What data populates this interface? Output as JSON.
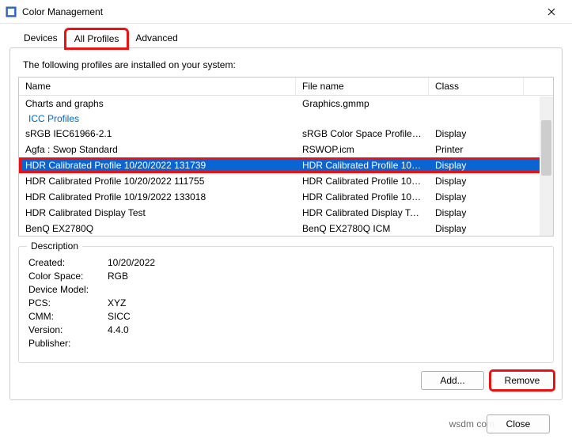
{
  "window": {
    "title": "Color Management"
  },
  "tabs": {
    "devices": "Devices",
    "all_profiles": "All Profiles",
    "advanced": "Advanced"
  },
  "intro": "The following profiles are installed on your system:",
  "columns": {
    "name": "Name",
    "file": "File name",
    "class": "Class"
  },
  "groups": {
    "icc": "ICC Profiles"
  },
  "rows": {
    "r0": {
      "name": "Charts and graphs",
      "file": "Graphics.gmmp",
      "class": ""
    },
    "r1": {
      "name": "sRGB IEC61966-2.1",
      "file": "sRGB Color Space Profile.ic...",
      "class": "Display"
    },
    "r2": {
      "name": "Agfa : Swop Standard",
      "file": "RSWOP.icm",
      "class": "Printer"
    },
    "r3": {
      "name": "HDR Calibrated Profile 10/20/2022 131739",
      "file": "HDR Calibrated Profile 10-...",
      "class": "Display"
    },
    "r4": {
      "name": "HDR Calibrated Profile 10/20/2022 111755",
      "file": "HDR Calibrated Profile 10-...",
      "class": "Display"
    },
    "r5": {
      "name": "HDR Calibrated Profile 10/19/2022 133018",
      "file": "HDR Calibrated Profile 10-...",
      "class": "Display"
    },
    "r6": {
      "name": "HDR Calibrated Display Test",
      "file": "HDR Calibrated Display Tes...",
      "class": "Display"
    },
    "r7": {
      "name": "BenQ EX2780Q",
      "file": "BenQ EX2780Q ICM",
      "class": "Display"
    }
  },
  "description": {
    "legend": "Description",
    "created_l": "Created:",
    "created_v": "10/20/2022",
    "cs_l": "Color Space:",
    "cs_v": "RGB",
    "dm_l": "Device Model:",
    "dm_v": "",
    "pcs_l": "PCS:",
    "pcs_v": "XYZ",
    "cmm_l": "CMM:",
    "cmm_v": "SICC",
    "ver_l": "Version:",
    "ver_v": "4.4.0",
    "pub_l": "Publisher:",
    "pub_v": ""
  },
  "buttons": {
    "add": "Add...",
    "remove": "Remove",
    "close": "Close"
  },
  "footer_stub": "wsdm com"
}
